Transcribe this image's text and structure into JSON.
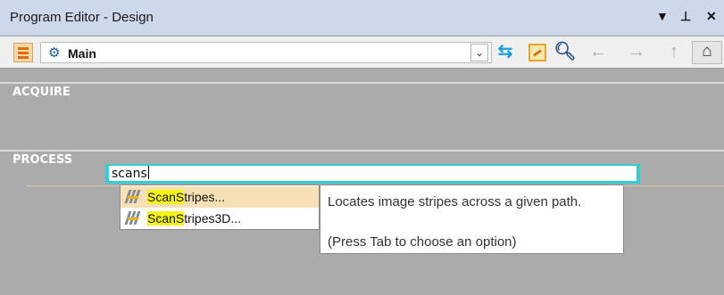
{
  "window": {
    "title": "Program Editor - Design",
    "dropdown_glyph": "▼",
    "pin_glyph": "⊥",
    "close_glyph": "✕"
  },
  "toolbar": {
    "scope_label": "Main",
    "tools": [
      "menu-icon",
      "gear-icon",
      "chevron-down-icon",
      "swap-icon",
      "edit-icon",
      "search-icon",
      "back-arrow-icon",
      "forward-arrow-icon",
      "up-arrow-icon",
      "home-icon"
    ]
  },
  "sections": [
    "ACQUIRE",
    "PROCESS"
  ],
  "search": {
    "value": "scans"
  },
  "suggestions": [
    {
      "match": "ScanS",
      "rest": "tripes...",
      "selected": true
    },
    {
      "match": "ScanS",
      "rest": "tripes3D...",
      "selected": false
    }
  ],
  "tooltip": {
    "description": "Locates image stripes across a given path.",
    "hint": "(Press Tab to choose an option)"
  },
  "colors": {
    "accent_cyan": "#2fcfd3",
    "highlight_yellow": "#f5f51a",
    "selected_row": "#f7dfb6",
    "panel_gray": "#ababab"
  }
}
